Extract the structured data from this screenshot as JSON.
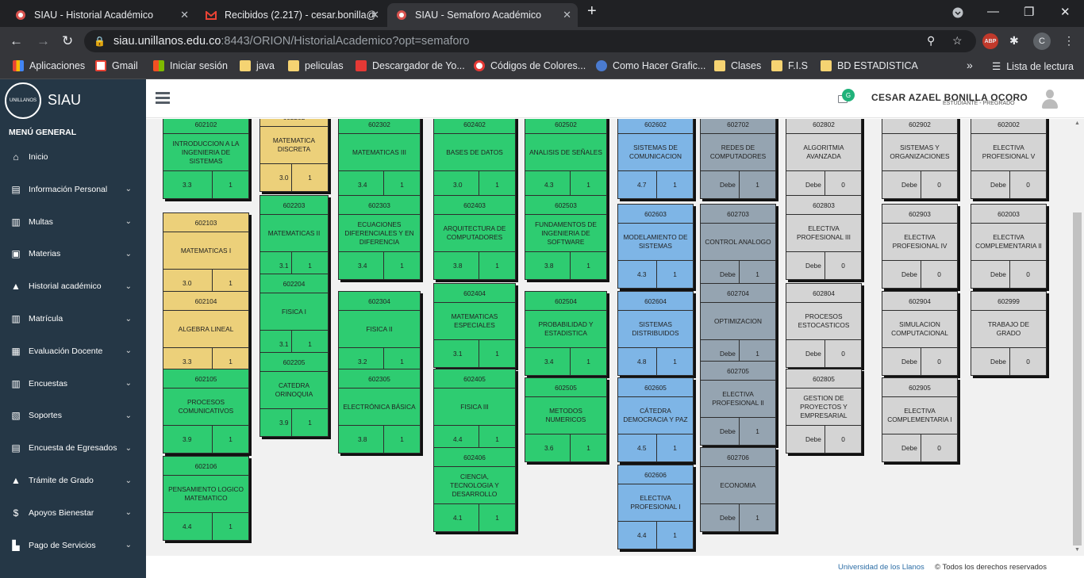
{
  "browser": {
    "tabs": [
      {
        "title": "SIAU - Historial Académico",
        "active": false,
        "icon": "siau-favicon"
      },
      {
        "title": "Recibidos (2.217) - cesar.bonilla@",
        "active": false,
        "icon": "gmail-icon"
      },
      {
        "title": "SIAU - Semaforo Académico",
        "active": true,
        "icon": "siau-favicon"
      }
    ],
    "new_tab": "+",
    "url_host": "siau.unillanos.edu.co",
    "url_path": ":8443/ORION/HistorialAcademico?opt=semaforo",
    "bookmarks": [
      {
        "label": "Aplicaciones",
        "icon": "apps-icon"
      },
      {
        "label": "Gmail",
        "icon": "gmail-icon"
      },
      {
        "label": "Iniciar sesión",
        "icon": "microsoft-icon"
      },
      {
        "label": "java",
        "icon": "folder-icon"
      },
      {
        "label": "peliculas",
        "icon": "folder-icon"
      },
      {
        "label": "Descargador de Yo...",
        "icon": "download-icon"
      },
      {
        "label": "Códigos de Colores...",
        "icon": "colors-icon"
      },
      {
        "label": "Como Hacer Grafic...",
        "icon": "web-icon"
      },
      {
        "label": "Clases",
        "icon": "folder-icon"
      },
      {
        "label": "F.I.S",
        "icon": "folder-icon"
      },
      {
        "label": "BD ESTADISTICA",
        "icon": "folder-icon"
      }
    ],
    "more": "»",
    "reading_list": "Lista de lectura",
    "profile_initial": "C",
    "abp": "ABP"
  },
  "app": {
    "title": "SIAU",
    "logo_text": "UNILLANOS",
    "menu_header": "MENÚ GENERAL",
    "menu": [
      {
        "label": "Inicio",
        "icon": "home-icon",
        "sub": false
      },
      {
        "label": "Información Personal",
        "icon": "id-card-icon",
        "sub": true
      },
      {
        "label": "Multas",
        "icon": "document-icon",
        "sub": true
      },
      {
        "label": "Materias",
        "icon": "book-open-icon",
        "sub": true
      },
      {
        "label": "Historial académico",
        "icon": "graduation-cap-icon",
        "sub": true
      },
      {
        "label": "Matrícula",
        "icon": "document-icon",
        "sub": true
      },
      {
        "label": "Evaluación Docente",
        "icon": "book-icon",
        "sub": true
      },
      {
        "label": "Encuestas",
        "icon": "document-icon",
        "sub": true
      },
      {
        "label": "Soportes",
        "icon": "folder-open-icon",
        "sub": true
      },
      {
        "label": "Encuesta de Egresados",
        "icon": "id-card-icon",
        "sub": true
      },
      {
        "label": "Trámite de Grado",
        "icon": "graduation-cap-icon",
        "sub": true
      },
      {
        "label": "Apoyos Bienestar",
        "icon": "dollar-icon",
        "sub": true
      },
      {
        "label": "Pago de Servicios",
        "icon": "cart-icon",
        "sub": true
      }
    ],
    "user_name": "CESAR AZAEL BONILLA OCORO",
    "user_role": "ESTUDIANTE - PREGRADO",
    "notification_badge": "G",
    "footer_link": "Universidad de los Llanos",
    "footer_text": "© Todos los derechos reservados"
  },
  "legend_colors": {
    "green": "#2ecc71",
    "yellow": "#ecd07a",
    "blue": "#7eb5e6",
    "slate": "#95a4b1",
    "gray": "#d4d4d4"
  },
  "courses": [
    {
      "code": "602102",
      "name": "INTRODUCCION A LA INGENIERIA DE SISTEMAS",
      "grade": "3.3",
      "credits": "1",
      "status": "green"
    },
    {
      "code": "602103",
      "name": "MATEMATICAS I",
      "grade": "3.0",
      "credits": "1",
      "status": "yellow"
    },
    {
      "code": "602104",
      "name": "ALGEBRA LINEAL",
      "grade": "3.3",
      "credits": "1",
      "status": "yellow"
    },
    {
      "code": "602105",
      "name": "PROCESOS COMUNICATIVOS",
      "grade": "3.9",
      "credits": "1",
      "status": "green"
    },
    {
      "code": "602106",
      "name": "PENSAMIENTO LOGICO MATEMATICO",
      "grade": "4.4",
      "credits": "1",
      "status": "green"
    },
    {
      "code": "602202",
      "name": "MATEMATICA DISCRETA",
      "grade": "3.0",
      "credits": "1",
      "status": "yellow"
    },
    {
      "code": "602203",
      "name": "MATEMATICAS II",
      "grade": "3.1",
      "credits": "1",
      "status": "green"
    },
    {
      "code": "602204",
      "name": "FISICA I",
      "grade": "3.1",
      "credits": "1",
      "status": "green"
    },
    {
      "code": "602205",
      "name": "CATEDRA ORINOQUIA",
      "grade": "3.9",
      "credits": "1",
      "status": "green"
    },
    {
      "code": "602302",
      "name": "MATEMATICAS III",
      "grade": "3.4",
      "credits": "1",
      "status": "green"
    },
    {
      "code": "602303",
      "name": "ECUACIONES DIFERENCIALES Y EN DIFERENCIA",
      "grade": "3.4",
      "credits": "1",
      "status": "green"
    },
    {
      "code": "602304",
      "name": "FISICA II",
      "grade": "3.2",
      "credits": "1",
      "status": "green"
    },
    {
      "code": "602305",
      "name": "ELECTRÓNICA BÁSICA",
      "grade": "3.8",
      "credits": "1",
      "status": "green"
    },
    {
      "code": "602402",
      "name": "BASES DE DATOS",
      "grade": "3.0",
      "credits": "1",
      "status": "green"
    },
    {
      "code": "602403",
      "name": "ARQUITECTURA DE COMPUTADORES",
      "grade": "3.8",
      "credits": "1",
      "status": "green"
    },
    {
      "code": "602404",
      "name": "MATEMATICAS ESPECIALES",
      "grade": "3.1",
      "credits": "1",
      "status": "green"
    },
    {
      "code": "602405",
      "name": "FISICA III",
      "grade": "4.4",
      "credits": "1",
      "status": "green"
    },
    {
      "code": "602406",
      "name": "CIENCIA, TECNOLOGIA Y DESARROLLO",
      "grade": "4.1",
      "credits": "1",
      "status": "green"
    },
    {
      "code": "602502",
      "name": "ANALISIS DE SEÑALES",
      "grade": "4.3",
      "credits": "1",
      "status": "green"
    },
    {
      "code": "602503",
      "name": "FUNDAMENTOS DE INGENIERIA DE SOFTWARE",
      "grade": "3.8",
      "credits": "1",
      "status": "green"
    },
    {
      "code": "602504",
      "name": "PROBABILIDAD Y ESTADISTICA",
      "grade": "3.4",
      "credits": "1",
      "status": "green"
    },
    {
      "code": "602505",
      "name": "METODOS NUMERICOS",
      "grade": "3.6",
      "credits": "1",
      "status": "green"
    },
    {
      "code": "602602",
      "name": "SISTEMAS DE COMUNICACION",
      "grade": "4.7",
      "credits": "1",
      "status": "blue"
    },
    {
      "code": "602603",
      "name": "MODELAMIENTO DE SISTEMAS",
      "grade": "4.3",
      "credits": "1",
      "status": "blue"
    },
    {
      "code": "602604",
      "name": "SISTEMAS DISTRIBUIDOS",
      "grade": "4.8",
      "credits": "1",
      "status": "blue"
    },
    {
      "code": "602605",
      "name": "CÁTEDRA DEMOCRACIA Y PAZ",
      "grade": "4.5",
      "credits": "1",
      "status": "blue"
    },
    {
      "code": "602606",
      "name": "ELECTIVA PROFESIONAL I",
      "grade": "4.4",
      "credits": "1",
      "status": "blue"
    },
    {
      "code": "602702",
      "name": "REDES DE COMPUTADORES",
      "grade": "Debe",
      "credits": "1",
      "status": "slate"
    },
    {
      "code": "602703",
      "name": "CONTROL ANALOGO",
      "grade": "Debe",
      "credits": "1",
      "status": "slate"
    },
    {
      "code": "602704",
      "name": "OPTIMIZACION",
      "grade": "Debe",
      "credits": "1",
      "status": "slate"
    },
    {
      "code": "602705",
      "name": "ELECTIVA PROFESIONAL II",
      "grade": "Debe",
      "credits": "1",
      "status": "slate"
    },
    {
      "code": "602706",
      "name": "ECONOMIA",
      "grade": "Debe",
      "credits": "1",
      "status": "slate"
    },
    {
      "code": "602802",
      "name": "ALGORITMIA AVANZADA",
      "grade": "Debe",
      "credits": "0",
      "status": "gray"
    },
    {
      "code": "602803",
      "name": "ELECTIVA PROFESIONAL III",
      "grade": "Debe",
      "credits": "0",
      "status": "gray"
    },
    {
      "code": "602804",
      "name": "PROCESOS ESTOCASTICOS",
      "grade": "Debe",
      "credits": "0",
      "status": "gray"
    },
    {
      "code": "602805",
      "name": "GESTION DE PROYECTOS Y EMPRESARIAL",
      "grade": "Debe",
      "credits": "0",
      "status": "gray"
    },
    {
      "code": "602902",
      "name": "SISTEMAS Y ORGANIZACIONES",
      "grade": "Debe",
      "credits": "0",
      "status": "gray"
    },
    {
      "code": "602903",
      "name": "ELECTIVA PROFESIONAL IV",
      "grade": "Debe",
      "credits": "0",
      "status": "gray"
    },
    {
      "code": "602904",
      "name": "SIMULACION COMPUTACIONAL",
      "grade": "Debe",
      "credits": "0",
      "status": "gray"
    },
    {
      "code": "602905",
      "name": "ELECTIVA COMPLEMENTARIA I",
      "grade": "Debe",
      "credits": "0",
      "status": "gray"
    },
    {
      "code": "602002",
      "name": "ELECTIVA PROFESIONAL V",
      "grade": "Debe",
      "credits": "0",
      "status": "gray"
    },
    {
      "code": "602003",
      "name": "ELECTIVA COMPLEMENTARIA II",
      "grade": "Debe",
      "credits": "0",
      "status": "gray"
    },
    {
      "code": "602999",
      "name": "TRABAJO DE GRADO",
      "grade": "Debe",
      "credits": "0",
      "status": "gray"
    }
  ]
}
